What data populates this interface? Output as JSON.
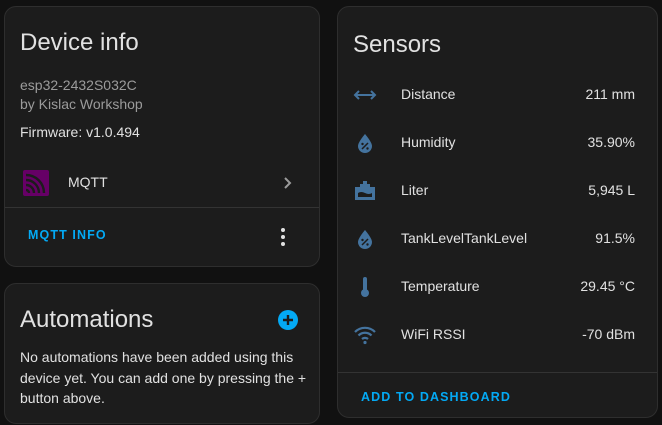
{
  "device_info": {
    "title": "Device info",
    "model": "esp32-2432S032C",
    "manufacturer": "by Kislac Workshop",
    "firmware": "Firmware: v1.0.494",
    "integration": {
      "label": "MQTT",
      "icon": "mqtt-icon"
    },
    "action_button": "MQTT INFO",
    "overflow_icon": "more-vert-icon"
  },
  "automations": {
    "title": "Automations",
    "add_icon": "plus-circle-icon",
    "empty_text": "No automations have been added using this device yet. You can add one by pressing the + button above."
  },
  "sensors": {
    "title": "Sensors",
    "items": [
      {
        "name": "Distance",
        "value": "211 mm",
        "icon": "arrow-left-right-icon"
      },
      {
        "name": "Humidity",
        "value": "35.90%",
        "icon": "water-percent-icon"
      },
      {
        "name": "Liter",
        "value": "5,945 L",
        "icon": "storage-tank-icon"
      },
      {
        "name": "TankLevelTankLevel",
        "value": "91.5%",
        "icon": "water-percent-icon"
      },
      {
        "name": "Temperature",
        "value": "29.45 °C",
        "icon": "thermometer-icon"
      },
      {
        "name": "WiFi RSSI",
        "value": "-70 dBm",
        "icon": "wifi-icon"
      }
    ],
    "action_button": "ADD TO DASHBOARD"
  },
  "colors": {
    "accent": "#03a9f4",
    "icon": "#44739e",
    "mqtt": "#660066",
    "card": "#1c1c1c",
    "background": "#111111"
  }
}
